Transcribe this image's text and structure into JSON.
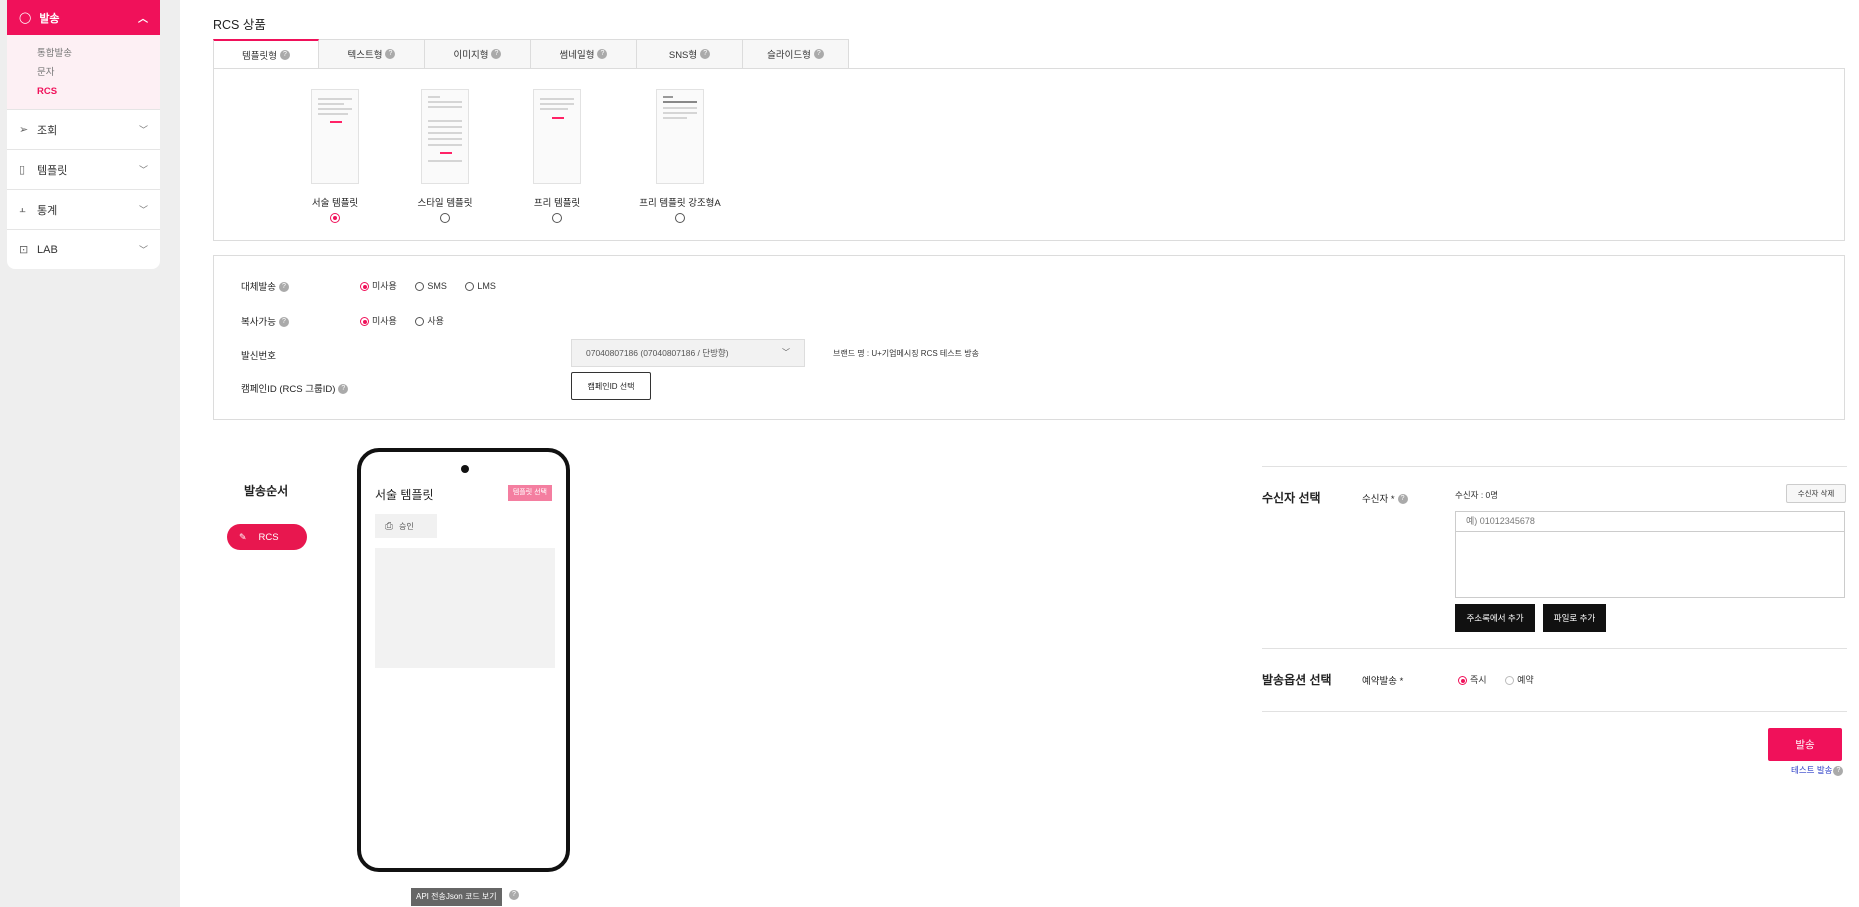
{
  "sidebar": {
    "active_label": "발송",
    "submenu": [
      "통합발송",
      "문자",
      "RCS"
    ],
    "items": [
      {
        "label": "조회",
        "icon": "send-icon"
      },
      {
        "label": "템플릿",
        "icon": "document-icon"
      },
      {
        "label": "통계",
        "icon": "bar-chart-icon"
      },
      {
        "label": "LAB",
        "icon": "lab-icon"
      }
    ]
  },
  "main": {
    "section_title": "RCS 상품",
    "tabs": [
      "템플릿형",
      "텍스트형",
      "이미지형",
      "썸네일형",
      "SNS형",
      "슬라이드형"
    ],
    "templates": [
      {
        "name": "서술 템플릿",
        "selected": true
      },
      {
        "name": "스타일 템플릿",
        "selected": false
      },
      {
        "name": "프리 템플릿",
        "selected": false
      },
      {
        "name": "프리 템플릿 강조형A",
        "selected": false
      }
    ],
    "options": {
      "fallback_label": "대체발송",
      "fallback_choices": [
        "미사용",
        "SMS",
        "LMS"
      ],
      "copy_label": "복사가능",
      "copy_choices": [
        "미사용",
        "사용"
      ],
      "sender_label": "발신번호",
      "sender_value": "07040807186 (07040807186 / 단방향)",
      "brand_text": "브랜드 명 : U+기업메시징 RCS 테스트 방송",
      "campaign_label": "캠페인ID (RCS 그룹ID)",
      "campaign_button": "캠페인ID 선택"
    }
  },
  "order": {
    "title": "발송순서",
    "pill_label": "RCS"
  },
  "preview": {
    "title": "서술 템플릿",
    "select_button": "템플릿 선택",
    "status": "승인",
    "json_button": "API 전송Json 코드 보기"
  },
  "recipients": {
    "section_title": "수신자 선택",
    "label": "수신자 *",
    "count": "수신자 : 0명",
    "delete_button": "수신자 삭제",
    "input_placeholder": "예) 01012345678",
    "address_button": "주소록에서 추가",
    "file_button": "파일로 추가"
  },
  "send_options": {
    "section_title": "발송옵션 선택",
    "label": "예약발송 *",
    "choices": [
      "즉시",
      "예약"
    ]
  },
  "actions": {
    "send_button": "발송",
    "test_link": "테스트 발송"
  },
  "colors": {
    "accent": "#f0115a"
  }
}
